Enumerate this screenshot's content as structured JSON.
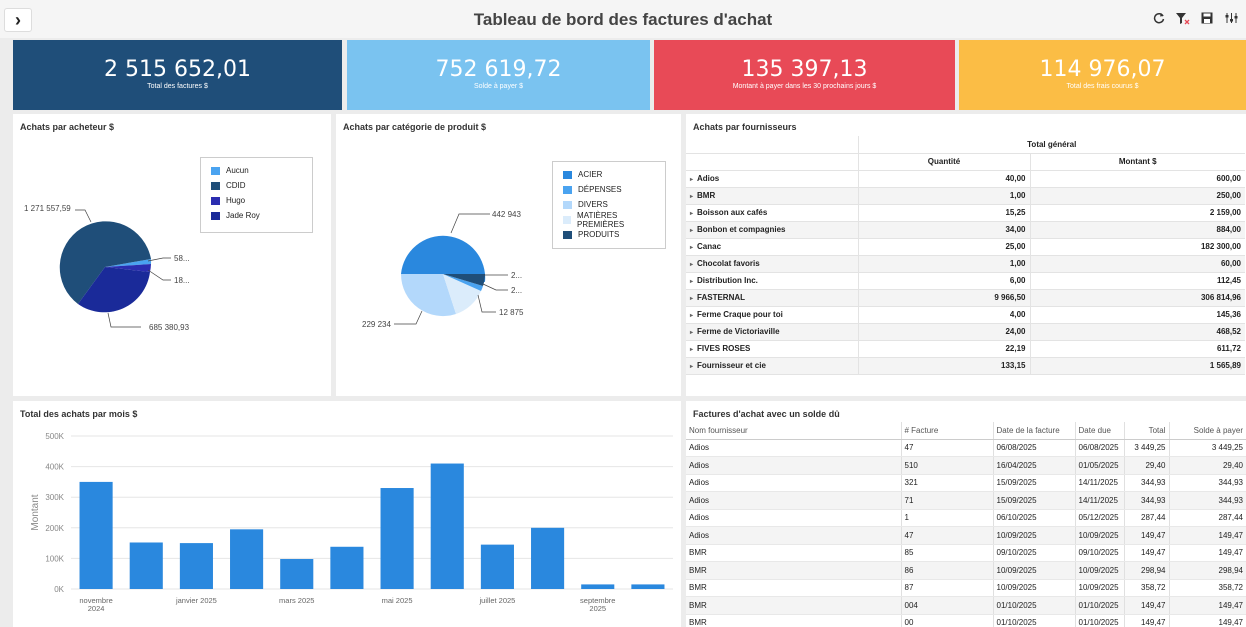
{
  "header": {
    "title": "Tableau de bord des factures d'achat",
    "nav_glyph": "›",
    "icons": [
      "refresh-icon",
      "clear-filter-icon",
      "save-icon",
      "settings-icon"
    ]
  },
  "kpis": [
    {
      "value": "2 515 652,01",
      "label": "Total des factures $",
      "color": "#1f4e79"
    },
    {
      "value": "752 619,72",
      "label": "Solde à payer $",
      "color": "#7ac3f0"
    },
    {
      "value": "135 397,13",
      "label": "Montant à payer dans les 30 prochains jours $",
      "color": "#e84a57"
    },
    {
      "value": "114 976,07",
      "label": "Total des frais courus $",
      "color": "#fbbd45"
    }
  ],
  "buyer_chart": {
    "title": "Achats par acheteur $",
    "legend": [
      {
        "label": "Aucun",
        "color": "#4aa3f0"
      },
      {
        "label": "CDID",
        "color": "#1f4e79"
      },
      {
        "label": "Hugo",
        "color": "#2b2db0"
      },
      {
        "label": "Jade Roy",
        "color": "#1a2a99"
      }
    ],
    "labels": [
      "1 271 557,59",
      "58...",
      "18...",
      "685 380,93"
    ]
  },
  "category_chart": {
    "title": "Achats par catégorie de produit $",
    "legend": [
      {
        "label": "ACIER",
        "color": "#2a88de"
      },
      {
        "label": "DÉPENSES",
        "color": "#4aa3f0"
      },
      {
        "label": "DIVERS",
        "color": "#b3d8fb"
      },
      {
        "label": "MATIÈRES PREMIÈRES",
        "color": "#dbecfb"
      },
      {
        "label": "PRODUITS",
        "color": "#1f4e79"
      }
    ],
    "labels": [
      "442 943",
      "2...",
      "2...",
      "12 875",
      "229 234"
    ]
  },
  "chart_data": [
    {
      "type": "pie",
      "title": "Achats par acheteur $",
      "categories": [
        "Aucun",
        "CDID",
        "Hugo",
        "Jade Roy"
      ],
      "values": [
        58000,
        1271557.59,
        685380.93,
        18000
      ]
    },
    {
      "type": "pie",
      "title": "Achats par catégorie de produit $",
      "categories": [
        "ACIER",
        "DÉPENSES",
        "DIVERS",
        "MATIÈRES PREMIÈRES",
        "PRODUITS"
      ],
      "values": [
        442943,
        2000,
        229234,
        12875,
        2000
      ]
    },
    {
      "type": "bar",
      "title": "Total des achats par mois $",
      "categories": [
        "novembre 2024",
        "décembre 2024",
        "janvier 2025",
        "février 2025",
        "mars 2025",
        "avril 2025",
        "mai 2025",
        "juin 2025",
        "juillet 2025",
        "août 2025",
        "septembre 2025",
        "octobre 2025"
      ],
      "values": [
        350000,
        152000,
        150000,
        195000,
        98000,
        138000,
        330000,
        410000,
        145000,
        200000,
        15000,
        15000
      ],
      "ylabel": "Montant",
      "ylim": [
        0,
        500000
      ],
      "yticks": [
        "0K",
        "100K",
        "200K",
        "300K",
        "400K",
        "500K"
      ],
      "xticks": [
        {
          "label": "novembre",
          "label2": "2024",
          "index": 0
        },
        {
          "label": "janvier 2025",
          "label2": "",
          "index": 2
        },
        {
          "label": "mars 2025",
          "label2": "",
          "index": 4
        },
        {
          "label": "mai 2025",
          "label2": "",
          "index": 6
        },
        {
          "label": "juillet 2025",
          "label2": "",
          "index": 8
        },
        {
          "label": "septembre",
          "label2": "2025",
          "index": 10
        }
      ],
      "color": "#2a88de"
    }
  ],
  "monthly": {
    "title": "Total des achats par mois $"
  },
  "suppliers": {
    "title": "Achats par fournisseurs",
    "group_header": "Total général",
    "col_qty": "Quantité",
    "col_amount": "Montant $",
    "rows": [
      {
        "name": "Adios",
        "qty": "40,00",
        "amount": "600,00"
      },
      {
        "name": "BMR",
        "qty": "1,00",
        "amount": "250,00"
      },
      {
        "name": "Boisson aux cafés",
        "qty": "15,25",
        "amount": "2 159,00"
      },
      {
        "name": "Bonbon et compagnies",
        "qty": "34,00",
        "amount": "884,00"
      },
      {
        "name": "Canac",
        "qty": "25,00",
        "amount": "182 300,00"
      },
      {
        "name": "Chocolat favoris",
        "qty": "1,00",
        "amount": "60,00"
      },
      {
        "name": "Distribution Inc.",
        "qty": "6,00",
        "amount": "112,45"
      },
      {
        "name": "FASTERNAL",
        "qty": "9 966,50",
        "amount": "306 814,96"
      },
      {
        "name": "Ferme Craque pour toi",
        "qty": "4,00",
        "amount": "145,36"
      },
      {
        "name": "Ferme de Victoriaville",
        "qty": "24,00",
        "amount": "468,52"
      },
      {
        "name": "FIVES ROSES",
        "qty": "22,19",
        "amount": "611,72"
      },
      {
        "name": "Fournisseur et cie",
        "qty": "133,15",
        "amount": "1 565,89"
      }
    ]
  },
  "invoices": {
    "title": "Factures d'achat avec un solde dû",
    "columns": [
      "Nom fournisseur",
      "# Facture",
      "Date de la facture",
      "Date due",
      "Total",
      "Solde à payer"
    ],
    "rows": [
      [
        "Adios",
        "47",
        "06/08/2025",
        "06/08/2025",
        "3 449,25",
        "3 449,25"
      ],
      [
        "Adios",
        "510",
        "16/04/2025",
        "01/05/2025",
        "29,40",
        "29,40"
      ],
      [
        "Adios",
        "321",
        "15/09/2025",
        "14/11/2025",
        "344,93",
        "344,93"
      ],
      [
        "Adios",
        "71",
        "15/09/2025",
        "14/11/2025",
        "344,93",
        "344,93"
      ],
      [
        "Adios",
        "1",
        "06/10/2025",
        "05/12/2025",
        "287,44",
        "287,44"
      ],
      [
        "Adios",
        "47",
        "10/09/2025",
        "10/09/2025",
        "149,47",
        "149,47"
      ],
      [
        "BMR",
        "85",
        "09/10/2025",
        "09/10/2025",
        "149,47",
        "149,47"
      ],
      [
        "BMR",
        "86",
        "10/09/2025",
        "10/09/2025",
        "298,94",
        "298,94"
      ],
      [
        "BMR",
        "87",
        "10/09/2025",
        "10/09/2025",
        "358,72",
        "358,72"
      ],
      [
        "BMR",
        "004",
        "01/10/2025",
        "01/10/2025",
        "149,47",
        "149,47"
      ],
      [
        "BMR",
        "00",
        "01/10/2025",
        "01/10/2025",
        "149,47",
        "149,47"
      ]
    ]
  }
}
